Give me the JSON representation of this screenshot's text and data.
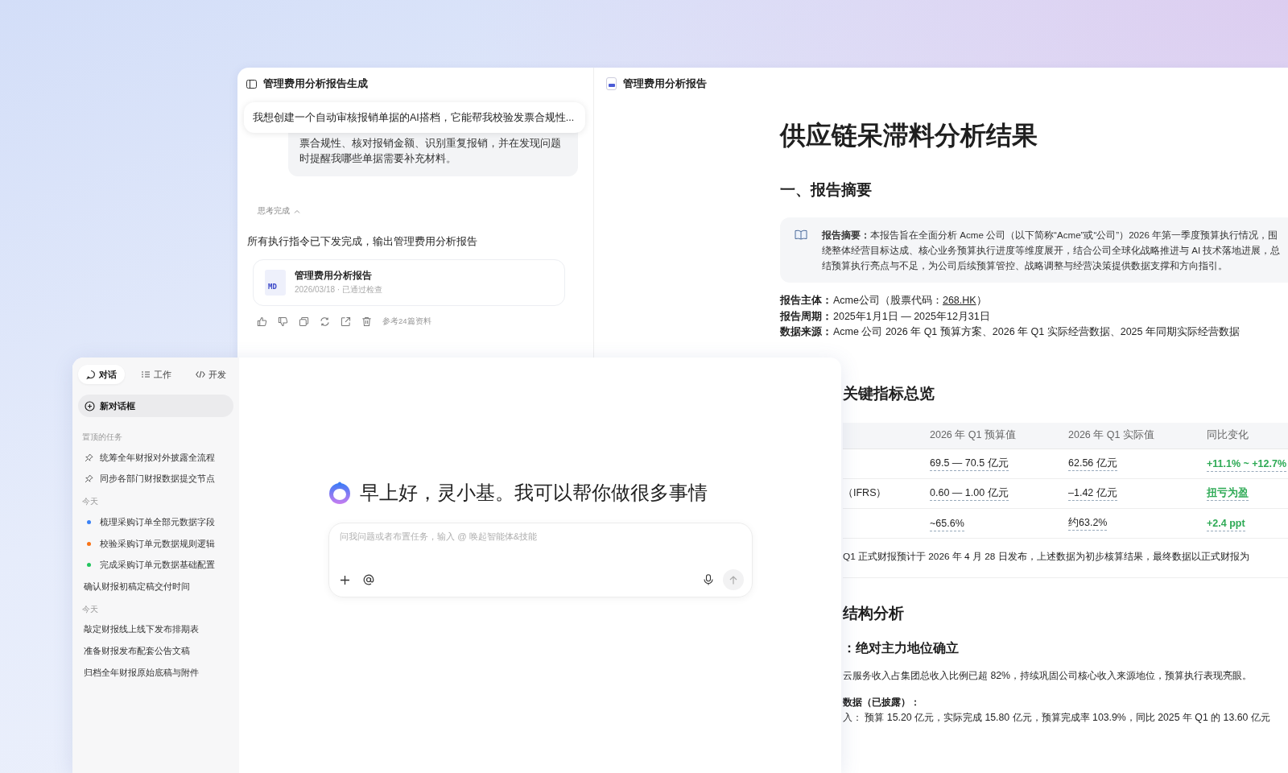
{
  "back_window": {
    "chat": {
      "title": "管理费用分析报告生成",
      "pinned_prompt": "我想创建一个自动审核报销单据的AI搭档，它能帮我校验发票合规性...",
      "user_message": "票合规性、核对报销金额、识别重复报销，并在发现问题时提醒我哪些单据需要补充材料。",
      "thinking_label": "思考完成",
      "reply": "所有执行指令已下发完成，输出管理费用分析报告",
      "file_card": {
        "badge": "MD",
        "title": "管理费用分析报告",
        "meta": "2026/03/18 · 已通过检查"
      },
      "references": "参考24篇资料"
    },
    "report": {
      "tab_title": "管理费用分析报告",
      "title": "供应链呆滞料分析结果",
      "section_1": "一、报告摘要",
      "summary": "**报告摘要：**本报告旨在全面分析 Acme 公司（以下简称“Acme”或“公司”）2026 年第一季度预算执行情况，围绕整体经营目标达成、核心业务预算执行进度等维度展开，结合公司全球化战略推进与 AI 技术落地进展，总结预算执行亮点与不足，为公司后续预算管控、战略调整与经营决策提供数据支撑和方向指引。",
      "meta": [
        {
          "label": "报告主体：",
          "value": "Acme公司（股票代码：",
          "link": "268.HK",
          "suffix": "）"
        },
        {
          "label": "报告周期：",
          "value": "2025年1月1日 — 2025年12月31日"
        },
        {
          "label": "数据来源：",
          "value": "Acme 公司 2026 年 Q1 预算方案、2026 年 Q1 实际经营数据、2025 年同期实际经营数据"
        }
      ],
      "section_2": "关键指标总览",
      "table": {
        "columns": [
          "2026 年 Q1 预算值",
          "2026 年 Q1 实际值",
          "同比变化"
        ],
        "rows": [
          {
            "budget": "69.5 — 70.5 亿元",
            "actual": "62.56 亿元",
            "change": "+11.1% ~ +12.7%"
          },
          {
            "label": "（IFRS）",
            "budget": "0.60 — 1.00 亿元",
            "actual": "–1.42 亿元",
            "change": "扭亏为盈"
          },
          {
            "budget": "~65.6%",
            "actual": "约63.2%",
            "change": "+2.4 ppt"
          }
        ],
        "note": "Q1 正式财报预计于 2026 年 4 月 28 日发布，上述数据为初步核算结果，最终数据以正式财报为"
      },
      "section_3": "结构分析",
      "subheading": "：绝对主力地位确立",
      "paragraph": "云服务收入占集团总收入比例已超 82%，持续巩固公司核心收入来源地位，预算执行表现亮眼。",
      "data_label": "数据（已披露）：",
      "data_line": "入：  预算 15.20 亿元，实际完成 15.80 亿元，预算完成率 103.9%，同比 2025 年 Q1 的 13.60 亿元"
    }
  },
  "front_window": {
    "tabs": [
      {
        "label": "对话",
        "selected": true
      },
      {
        "label": "工作",
        "selected": false
      },
      {
        "label": "开发",
        "selected": false
      }
    ],
    "new_chat": "新对话框",
    "sections": [
      {
        "heading": "置顶的任务",
        "items": [
          {
            "kind": "pinned",
            "label": "统筹全年财报对外披露全流程"
          },
          {
            "kind": "pinned",
            "label": "同步各部门财报数据提交节点"
          }
        ]
      },
      {
        "heading": "今天",
        "items": [
          {
            "kind": "dot",
            "color": "#3b82f6",
            "label": "梳理采购订单全部元数据字段"
          },
          {
            "kind": "dot",
            "color": "#f97316",
            "label": "校验采购订单元数据规则逻辑"
          },
          {
            "kind": "dot",
            "color": "#22c55e",
            "label": "完成采购订单元数据基础配置"
          },
          {
            "kind": "plain",
            "label": "确认财报初稿定稿交付时间"
          }
        ]
      },
      {
        "heading": "今天",
        "items": [
          {
            "kind": "plain",
            "label": "敲定财报线上线下发布排期表"
          },
          {
            "kind": "plain",
            "label": "准备财报发布配套公告文稿"
          },
          {
            "kind": "plain",
            "label": "归档全年财报原始底稿与附件"
          }
        ]
      }
    ],
    "greeting": "早上好，灵小基。我可以帮你做很多事情",
    "input": {
      "placeholder": "问我问题或者布置任务，输入 @ 唤起智能体&技能"
    }
  }
}
